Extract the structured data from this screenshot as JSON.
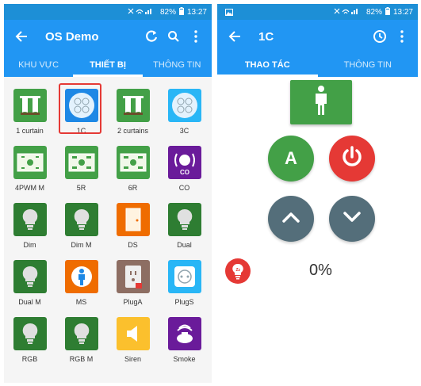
{
  "status_bar": {
    "battery": "82%",
    "time": "13:27"
  },
  "left": {
    "title": "OS Demo",
    "tabs": [
      {
        "label": "KHU VỰC",
        "active": false
      },
      {
        "label": "THIẾT BỊ",
        "active": true
      },
      {
        "label": "THÔNG TIN",
        "active": false
      }
    ],
    "devices": [
      {
        "label": "1 curtain",
        "icon": "curtain-icon",
        "color": "#43a047"
      },
      {
        "label": "1C",
        "icon": "scene-keypad-icon",
        "color": "#1e88e5",
        "selected": true
      },
      {
        "label": "2 curtains",
        "icon": "curtain-icon",
        "color": "#43a047"
      },
      {
        "label": "3C",
        "icon": "scene-keypad-icon",
        "color": "#29b6f6"
      },
      {
        "label": "4PWM M",
        "icon": "dimmer-panel-icon",
        "color": "#43a047"
      },
      {
        "label": "5R",
        "icon": "relay-panel-icon",
        "color": "#43a047"
      },
      {
        "label": "6R",
        "icon": "relay-panel-icon",
        "color": "#43a047"
      },
      {
        "label": "CO",
        "icon": "co-alarm-icon",
        "color": "#6a1b9a"
      },
      {
        "label": "Dim",
        "icon": "bulb-icon",
        "color": "#2e7d32"
      },
      {
        "label": "Dim M",
        "icon": "bulb-icon",
        "color": "#2e7d32"
      },
      {
        "label": "DS",
        "icon": "door-sensor-icon",
        "color": "#ef6c00"
      },
      {
        "label": "Dual",
        "icon": "bulb-icon",
        "color": "#2e7d32"
      },
      {
        "label": "Dual M",
        "icon": "bulb-icon",
        "color": "#2e7d32"
      },
      {
        "label": "MS",
        "icon": "motion-sensor-icon",
        "color": "#ef6c00"
      },
      {
        "label": "PlugA",
        "icon": "plug-a-icon",
        "color": "#8d6e63"
      },
      {
        "label": "PlugS",
        "icon": "plug-s-icon",
        "color": "#29b6f6"
      },
      {
        "label": "RGB",
        "icon": "bulb-icon",
        "color": "#2e7d32"
      },
      {
        "label": "RGB M",
        "icon": "bulb-icon",
        "color": "#2e7d32"
      },
      {
        "label": "Siren",
        "icon": "siren-icon",
        "color": "#fbc02d"
      },
      {
        "label": "Smoke",
        "icon": "smoke-detector-icon",
        "color": "#6a1b9a"
      }
    ]
  },
  "right": {
    "title": "1C",
    "tabs": [
      {
        "label": "THAO TÁC",
        "active": true
      },
      {
        "label": "THÔNG TIN",
        "active": false
      }
    ],
    "a_button_label": "A",
    "level_percent": "0%"
  },
  "colors": {
    "status_bar": "#1d8fd6",
    "app_bar": "#2196f3",
    "green": "#43a047",
    "red": "#e53935",
    "slate": "#546e7a"
  }
}
